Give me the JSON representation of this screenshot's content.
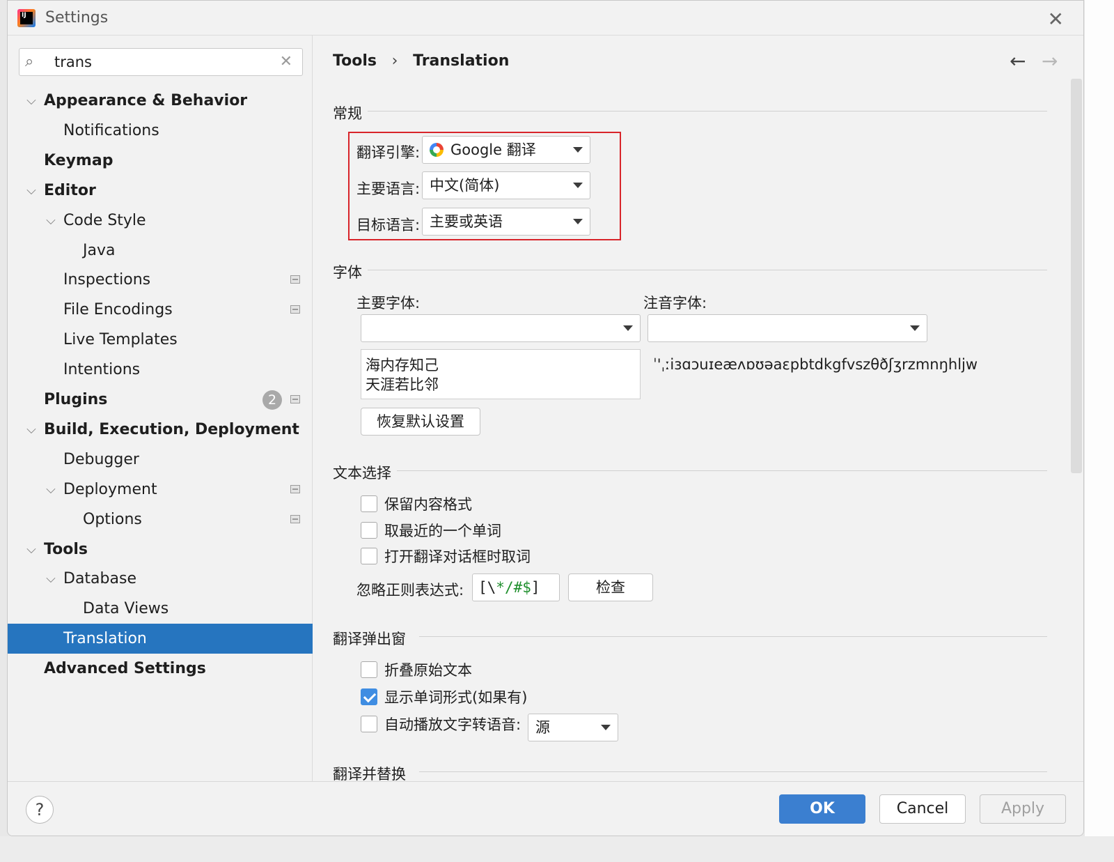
{
  "window": {
    "title": "Settings",
    "close_glyph": "✕",
    "app_icon": "IJ"
  },
  "search": {
    "value": "trans",
    "clear_glyph": "✕"
  },
  "sidebar": {
    "items": [
      {
        "label": "Appearance & Behavior",
        "level": 0,
        "expanded": true,
        "bold": true
      },
      {
        "label": "Notifications",
        "level": 1
      },
      {
        "label": "Keymap",
        "level": 0,
        "bold": true
      },
      {
        "label": "Editor",
        "level": 0,
        "expanded": true,
        "bold": true
      },
      {
        "label": "Code Style",
        "level": 1,
        "expanded": true
      },
      {
        "label": "Java",
        "level": 2
      },
      {
        "label": "Inspections",
        "level": 1,
        "project_icon": true
      },
      {
        "label": "File Encodings",
        "level": 1,
        "project_icon": true
      },
      {
        "label": "Live Templates",
        "level": 1
      },
      {
        "label": "Intentions",
        "level": 1
      },
      {
        "label": "Plugins",
        "level": 0,
        "bold": true,
        "badge": "2",
        "project_icon": true
      },
      {
        "label": "Build, Execution, Deployment",
        "level": 0,
        "expanded": true,
        "bold": true
      },
      {
        "label": "Debugger",
        "level": 1
      },
      {
        "label": "Deployment",
        "level": 1,
        "expanded": true,
        "project_icon": true
      },
      {
        "label": "Options",
        "level": 2,
        "project_icon": true
      },
      {
        "label": "Tools",
        "level": 0,
        "expanded": true,
        "bold": true
      },
      {
        "label": "Database",
        "level": 1,
        "expanded": true
      },
      {
        "label": "Data Views",
        "level": 2
      },
      {
        "label": "Translation",
        "level": 1,
        "selected": true
      },
      {
        "label": "Advanced Settings",
        "level": 0,
        "bold": true
      }
    ]
  },
  "breadcrumb": {
    "parent": "Tools",
    "separator": "›",
    "current": "Translation"
  },
  "nav": {
    "back": "←",
    "forward": "→"
  },
  "general": {
    "title": "常规",
    "engine_label": "翻译引擎:",
    "engine_value": "Google 翻译",
    "primary_lang_label": "主要语言:",
    "primary_lang_value": "中文(简体)",
    "target_lang_label": "目标语言:",
    "target_lang_value": "主要或英语"
  },
  "font": {
    "title": "字体",
    "primary_font_label": "主要字体:",
    "phonetic_font_label": "注音字体:",
    "preview_line1": "海内存知己",
    "preview_line2": "天涯若比邻",
    "phonetic_preview": "ˈ'ˌːiɜɑɔuɪeæʌɒʊəaεpbtdkgfvszθðʃʒrzmnŋhljw",
    "reset_button": "恢复默认设置"
  },
  "text_selection": {
    "title": "文本选择",
    "options": [
      {
        "label": "保留内容格式",
        "checked": false
      },
      {
        "label": "取最近的一个单词",
        "checked": false
      },
      {
        "label": "打开翻译对话框时取词",
        "checked": false
      }
    ],
    "regex_label": "忽略正则表达式:",
    "regex_part1": "[\\",
    "regex_part2": "*/#$",
    "regex_part3": "]",
    "check_button": "检查"
  },
  "popup": {
    "title": "翻译弹出窗",
    "options": [
      {
        "label": "折叠原始文本",
        "checked": false
      },
      {
        "label": "显示单词形式(如果有)",
        "checked": true
      },
      {
        "label": "自动播放文字转语音:",
        "checked": false
      }
    ],
    "tts_value": "源"
  },
  "replace": {
    "title": "翻译并替换"
  },
  "footer": {
    "help": "?",
    "ok": "OK",
    "cancel": "Cancel",
    "apply": "Apply"
  },
  "colors": {
    "accent": "#2675bf",
    "ok_button": "#3b7fd0",
    "highlight_border": "#d8242a",
    "checkbox_checked": "#3f8de2"
  }
}
